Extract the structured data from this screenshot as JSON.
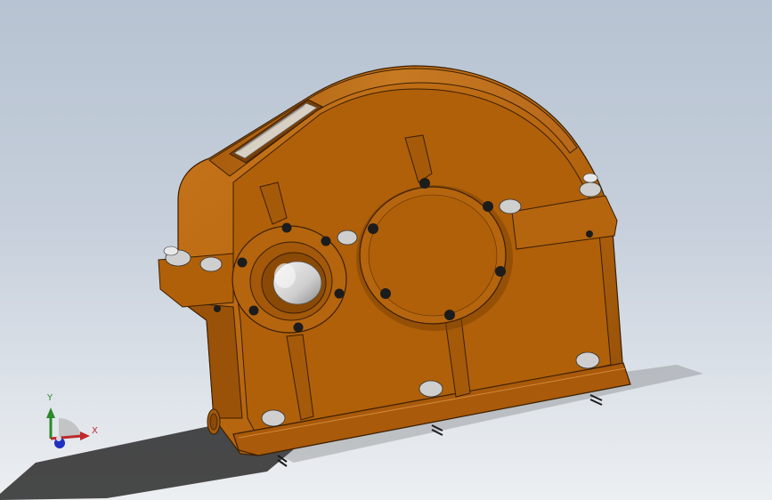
{
  "viewport": {
    "background_top": "#b7c3d2",
    "background_bottom": "#eceff2"
  },
  "model": {
    "name": "gearbox-housing",
    "body_color": "#b5650e",
    "dark_color": "#7a3f04",
    "edge_color": "#3a1f02",
    "shaft_color": "#d7d7d7",
    "bolt_color": "#1c1c1c",
    "window_color": "#d9d0c4"
  },
  "triad": {
    "x_label": "X",
    "y_label": "Y",
    "x_color": "#c0292b",
    "y_color": "#2a8a2a",
    "z_color": "#1f2fbf",
    "icon": "coordinate-triad-icon"
  }
}
